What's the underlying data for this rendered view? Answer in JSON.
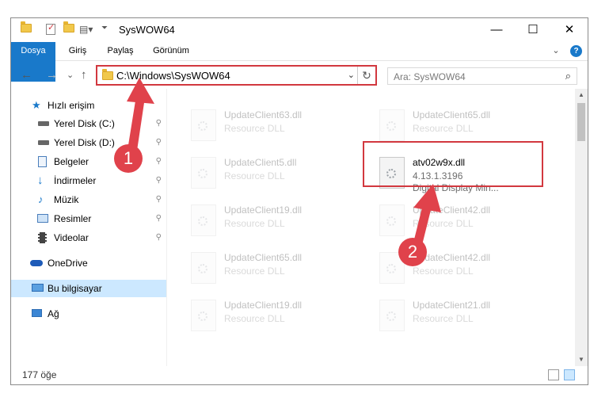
{
  "titlebar": {
    "title": "SysWOW64",
    "minimize": "—",
    "maximize": "☐",
    "close": "✕"
  },
  "ribbon": {
    "tabs": [
      "Dosya",
      "Giriş",
      "Paylaş",
      "Görünüm"
    ],
    "expand": "⌄",
    "help": "?"
  },
  "address": {
    "path": "C:\\Windows\\SysWOW64",
    "dropdown": "⌄",
    "refresh": "↻"
  },
  "nav": {
    "back": "←",
    "forward": "→",
    "recent": "⌄",
    "up": "↑"
  },
  "search": {
    "placeholder": "Ara: SysWOW64",
    "icon": "⌕"
  },
  "sidebar": {
    "items": [
      {
        "label": "Hızlı erişim",
        "icon": "star-icon",
        "pin": ""
      },
      {
        "label": "Yerel Disk (C:)",
        "icon": "drive-icon",
        "pin": "📌"
      },
      {
        "label": "Yerel Disk (D:)",
        "icon": "drive-icon",
        "pin": "📌"
      },
      {
        "label": "Belgeler",
        "icon": "document-icon",
        "pin": "📌"
      },
      {
        "label": "İndirmeler",
        "icon": "download-icon",
        "pin": "📌"
      },
      {
        "label": "Müzik",
        "icon": "music-icon",
        "pin": "📌"
      },
      {
        "label": "Resimler",
        "icon": "pictures-icon",
        "pin": "📌"
      },
      {
        "label": "Videolar",
        "icon": "video-icon",
        "pin": "📌"
      },
      {
        "label": "OneDrive",
        "icon": "cloud-icon",
        "pin": ""
      },
      {
        "label": "Bu bilgisayar",
        "icon": "computer-icon",
        "pin": ""
      },
      {
        "label": "Ağ",
        "icon": "network-icon",
        "pin": ""
      }
    ]
  },
  "files": [
    {
      "name": "UpdateClient63.dll",
      "desc": "Resource DLL"
    },
    {
      "name": "UpdateClient65.dll",
      "desc": "Resource DLL"
    },
    {
      "name": "UpdateClient5.dll",
      "desc": "Resource DLL"
    },
    {
      "name": "atv02w9x.dll",
      "desc": "4.13.1.3196",
      "desc2": "Digital Display Min..."
    },
    {
      "name": "UpdateClient19.dll",
      "desc": "Resource DLL"
    },
    {
      "name": "UpdateClient42.dll",
      "desc": "Resource DLL"
    },
    {
      "name": "UpdateClient65.dll",
      "desc": "Resource DLL"
    },
    {
      "name": "UpdateClient42.dll",
      "desc": "Resource DLL"
    },
    {
      "name": "UpdateClient19.dll",
      "desc": "Resource DLL"
    },
    {
      "name": "UpdateClient21.dll",
      "desc": "Resource DLL"
    }
  ],
  "status": {
    "count": "177 öğe"
  },
  "annotations": {
    "badge1": "1",
    "badge2": "2"
  },
  "colors": {
    "accent": "#1979ca",
    "highlight": "#d2383f",
    "selected": "#cce8ff"
  }
}
